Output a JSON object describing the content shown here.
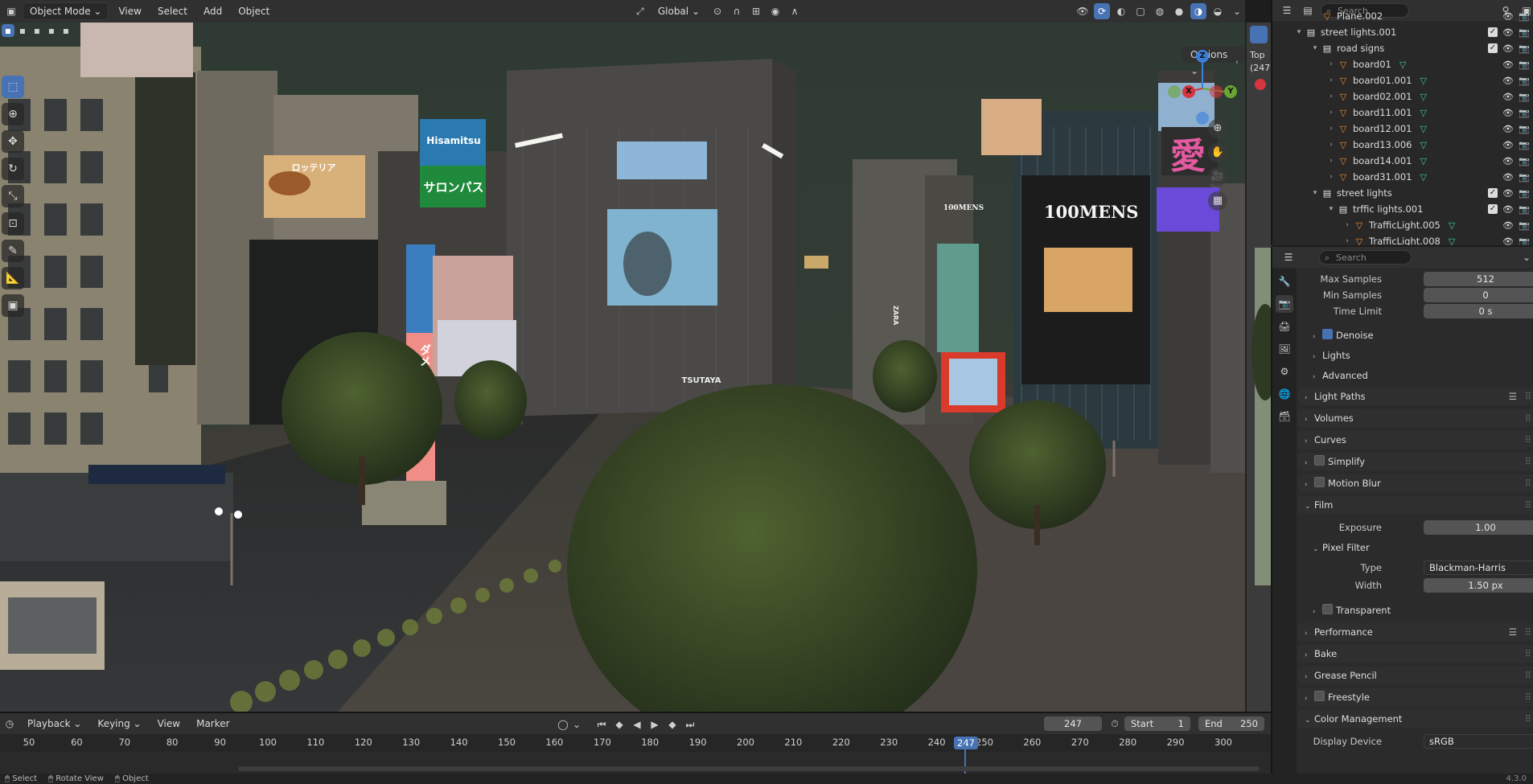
{
  "header": {
    "mode": "Object Mode",
    "menus": [
      "View",
      "Select",
      "Add",
      "Object"
    ],
    "orientation": "Global",
    "options_label": "Options"
  },
  "scene_text": {
    "billboard_hisamitsu": "Hisamitsu",
    "billboard_salonpas": "サロンパス",
    "billboard_100mens_a": "100MENS",
    "billboard_100mens_b": "100MENS",
    "billboard_tsutaya": "TSUTAYA",
    "billboard_zara": "ZARA",
    "billboard_ai": "愛",
    "billboard_burger": "ロッテリア",
    "billboard_vertical": "ダメ"
  },
  "gizmo": {
    "z": "Z",
    "y": "Y",
    "x": "X"
  },
  "side_viewport": {
    "label1": "Top",
    "label2": "(247"
  },
  "outliner": {
    "search_placeholder": "Search",
    "rows": [
      {
        "name": "Plane.002",
        "indent": 2,
        "icon": "mesh",
        "arrow": "",
        "partial": true
      },
      {
        "name": "street lights.001",
        "indent": 1,
        "icon": "collection",
        "arrow": "▾",
        "check": true
      },
      {
        "name": "road signs",
        "indent": 2,
        "icon": "collection",
        "arrow": "▾",
        "check": true
      },
      {
        "name": "board01",
        "indent": 3,
        "icon": "mesh",
        "arrow": "›",
        "tri": true
      },
      {
        "name": "board01.001",
        "indent": 3,
        "icon": "mesh",
        "arrow": "›",
        "tri": true
      },
      {
        "name": "board02.001",
        "indent": 3,
        "icon": "mesh",
        "arrow": "›",
        "tri": true
      },
      {
        "name": "board11.001",
        "indent": 3,
        "icon": "mesh",
        "arrow": "›",
        "tri": true
      },
      {
        "name": "board12.001",
        "indent": 3,
        "icon": "mesh",
        "arrow": "›",
        "tri": true
      },
      {
        "name": "board13.006",
        "indent": 3,
        "icon": "mesh",
        "arrow": "›",
        "tri": true
      },
      {
        "name": "board14.001",
        "indent": 3,
        "icon": "mesh",
        "arrow": "›",
        "tri": true
      },
      {
        "name": "board31.001",
        "indent": 3,
        "icon": "mesh",
        "arrow": "›",
        "tri": true
      },
      {
        "name": "street lights",
        "indent": 2,
        "icon": "collection",
        "arrow": "▾",
        "check": true
      },
      {
        "name": "trffic lights.001",
        "indent": 3,
        "icon": "collection",
        "arrow": "▾",
        "check": true
      },
      {
        "name": "TrafficLight.005",
        "indent": 4,
        "icon": "mesh",
        "arrow": "›",
        "tri": true
      },
      {
        "name": "TrafficLight.008",
        "indent": 4,
        "icon": "mesh",
        "arrow": "›",
        "tri": true,
        "partial": true
      }
    ]
  },
  "properties": {
    "search_placeholder": "Search",
    "max_samples_label": "Max Samples",
    "max_samples": "512",
    "min_samples_label": "Min Samples",
    "min_samples": "0",
    "time_limit_label": "Time Limit",
    "time_limit": "0 s",
    "denoise": "Denoise",
    "lights": "Lights",
    "advanced": "Advanced",
    "light_paths": "Light Paths",
    "volumes": "Volumes",
    "curves": "Curves",
    "simplify": "Simplify",
    "motion_blur": "Motion Blur",
    "film": "Film",
    "exposure_label": "Exposure",
    "exposure": "1.00",
    "pixel_filter": "Pixel Filter",
    "type_label": "Type",
    "type": "Blackman-Harris",
    "width_label": "Width",
    "width": "1.50 px",
    "transparent": "Transparent",
    "performance": "Performance",
    "bake": "Bake",
    "grease_pencil": "Grease Pencil",
    "freestyle": "Freestyle",
    "color_management": "Color Management",
    "display_device_label": "Display Device",
    "display_device": "sRGB"
  },
  "timeline": {
    "menus": [
      "Playback",
      "Keying",
      "View",
      "Marker"
    ],
    "current_frame": "247",
    "start_label": "Start",
    "start": "1",
    "end_label": "End",
    "end": "250",
    "ruler_ticks": [
      "50",
      "60",
      "70",
      "80",
      "90",
      "100",
      "110",
      "120",
      "130",
      "140",
      "150",
      "160",
      "170",
      "180",
      "190",
      "200",
      "210",
      "220",
      "230",
      "240",
      "250",
      "260",
      "270",
      "280",
      "290",
      "300"
    ],
    "playhead_label": "247"
  },
  "status": {
    "select": "Select",
    "rotate": "Rotate View",
    "object": "Object",
    "version": "4.3.0"
  }
}
